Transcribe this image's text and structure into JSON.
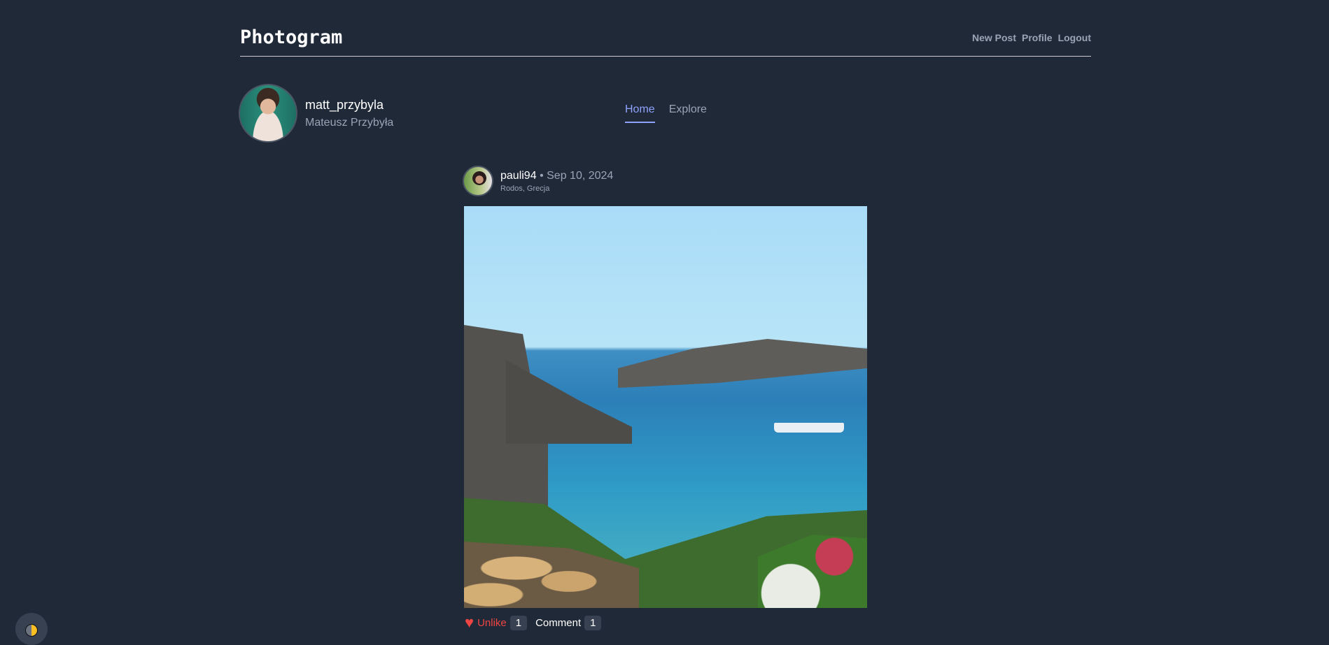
{
  "header": {
    "title": "Photogram",
    "nav": [
      "New Post",
      "Profile",
      "Logout"
    ]
  },
  "user": {
    "username": "matt_przybyla",
    "full_name": "Mateusz Przybyła"
  },
  "tabs": [
    {
      "label": "Home",
      "active": true
    },
    {
      "label": "Explore",
      "active": false
    }
  ],
  "post": {
    "author": "pauli94",
    "separator": "•",
    "date": "Sep 10, 2024",
    "location": "Rodos, Grecja",
    "like_label": "Unlike",
    "like_count": "1",
    "comment_label": "Comment",
    "comment_count": "1"
  },
  "colors": {
    "background": "#202938",
    "accent": "#8ea2ff",
    "like": "#ef4444"
  }
}
